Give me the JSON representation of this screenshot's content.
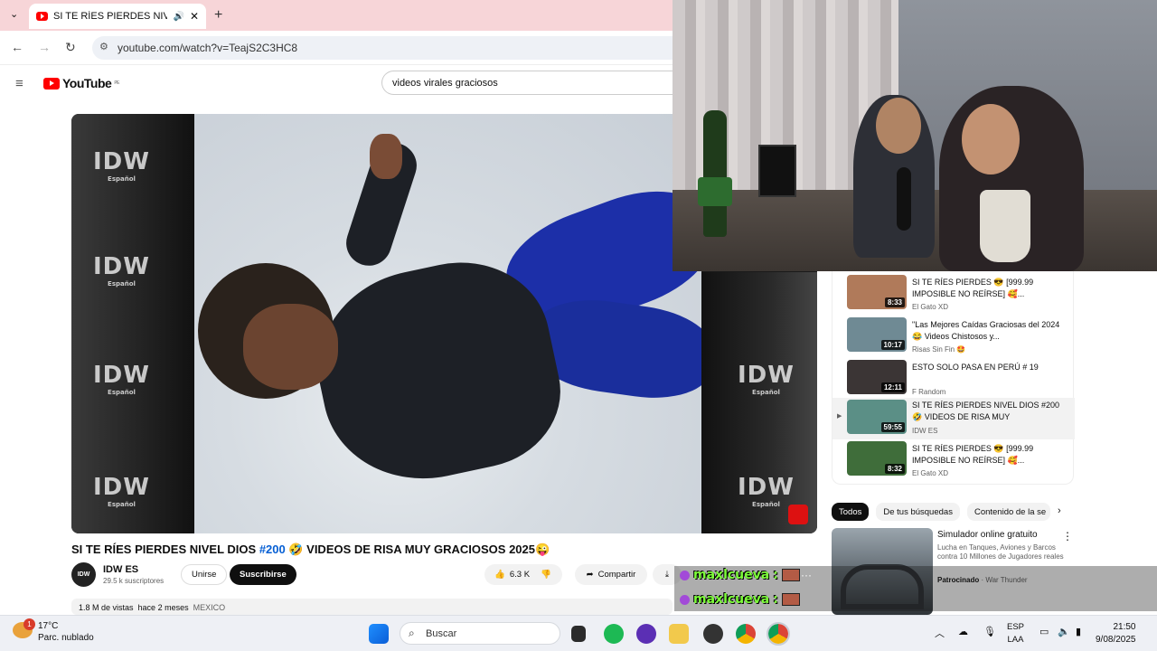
{
  "browser": {
    "tab_title": "SI TE RÍES PIERDES NIVEL D",
    "url": "youtube.com/watch?v=TeajS2C3HC8"
  },
  "youtube": {
    "logo_text": "YouTube",
    "logo_region": "PE",
    "search_value": "videos virales graciosos"
  },
  "player": {
    "watermark": "IDW",
    "watermark_sub": "Español"
  },
  "video": {
    "title_pre": "SI TE RÍES PIERDES NIVEL DIOS ",
    "title_hash": "#200",
    "title_post": " 🤣 VIDEOS DE RISA MUY GRACIOSOS 2025😜",
    "channel_initials": "IDW",
    "channel": "IDW ES",
    "subscribers": "29.5 k suscriptores",
    "join_label": "Unirse",
    "subscribe_label": "Suscribirse",
    "likes": "6.3 K",
    "share_label": "Compartir",
    "views": "1.8 M de vistas",
    "age": "hace 2 meses",
    "tag": "MEXICO"
  },
  "recommendations": [
    {
      "title": "SI TE RÍES PIERDES 😎 [999.99 IMPOSIBLE NO REÍRSE] 🥰...",
      "channel": "El Gato XD",
      "duration": "8:33",
      "color": "#b07a5a"
    },
    {
      "title": "\"Las Mejores Caídas Graciosas del 2024 😂 Videos Chistosos y...",
      "channel": "Risas Sin Fin 🤩",
      "duration": "10:17",
      "color": "#6f8a94"
    },
    {
      "title": "ESTO SOLO PASA EN PERÚ # 19",
      "channel": "F Random",
      "duration": "12:11",
      "color": "#3b3535"
    },
    {
      "title": "SI TE RÍES PIERDES NIVEL DIOS #200 🤣 VIDEOS DE RISA MUY GRACIOSOS...",
      "channel": "IDW ES",
      "duration": "59:55",
      "color": "#5b8f86"
    },
    {
      "title": "SI TE RÍES PIERDES 😎 [999.99 IMPOSIBLE NO REÍRSE] 🥰...",
      "channel": "El Gato XD",
      "duration": "8:32",
      "color": "#3f6d3a"
    }
  ],
  "chips": [
    "Todos",
    "De tus búsquedas",
    "Contenido de la se"
  ],
  "ad": {
    "title": "Simulador online gratuito",
    "description": "Lucha en Tanques, Aviones y Barcos contra 10 Millones de Jugadores reales",
    "sponsored": "Patrocinado",
    "advertiser": "War Thunder"
  },
  "chat": [
    {
      "user": "maxlcueva"
    },
    {
      "user": "maxlcueva"
    }
  ],
  "taskbar": {
    "temp": "17°C",
    "weather": "Parc. nublado",
    "weather_badge": "1",
    "search_placeholder": "Buscar",
    "lang_1": "ESP",
    "lang_2": "LAA",
    "time": "21:50",
    "date": "9/08/2025"
  }
}
